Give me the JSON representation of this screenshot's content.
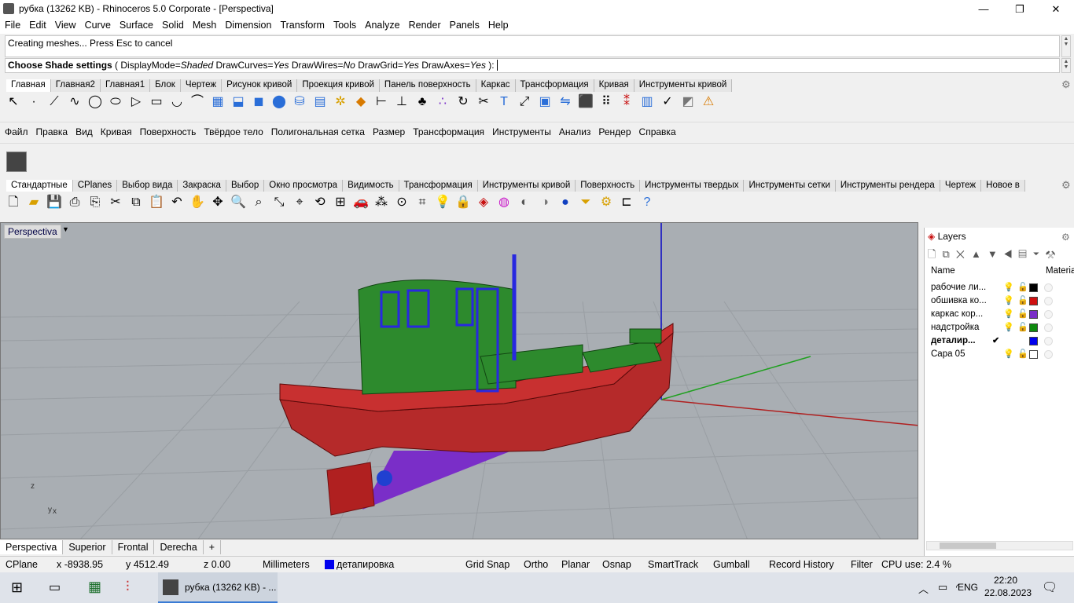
{
  "window": {
    "title": "рубка (13262 KB) - Rhinoceros  5.0 Corporate - [Perspectiva]",
    "minimize": "—",
    "restore": "❐",
    "close": "✕"
  },
  "menu": [
    "File",
    "Edit",
    "View",
    "Curve",
    "Surface",
    "Solid",
    "Mesh",
    "Dimension",
    "Transform",
    "Tools",
    "Analyze",
    "Render",
    "Panels",
    "Help"
  ],
  "command": {
    "history": "Creating meshes... Press Esc to cancel",
    "prompt_bold": "Choose Shade settings",
    "prompt_rest": " ( DisplayMode=",
    "displaymode": "Shaded",
    "drawcurves_lbl": " DrawCurves=",
    "drawcurves": "Yes",
    "drawwires_lbl": " DrawWires=",
    "drawwires": "No",
    "drawgrid_lbl": " DrawGrid=",
    "drawgrid": "Yes",
    "drawaxes_lbl": " DrawAxes=",
    "drawaxes": "Yes",
    "prompt_end": " ): "
  },
  "toolbar_tabs1": [
    "Главная",
    "Главная2",
    "Главная1",
    "Блок",
    "Чертеж",
    "Рисунок кривой",
    "Проекция кривой",
    "Панель поверхность",
    "Каркас",
    "Трансформация",
    "Кривая",
    "Инструменты кривой"
  ],
  "toolbar_text": [
    "Файл",
    "Правка",
    "Вид",
    "Кривая",
    "Поверхность",
    "Твёрдое тело",
    "Полигональная сетка",
    "Размер",
    "Трансформация",
    "Инструменты",
    "Анализ",
    "Рендер",
    "Справка"
  ],
  "toolbar_tabs2": [
    "Стандартные",
    "CPlanes",
    "Выбор вида",
    "Закраска",
    "Выбор",
    "Окно просмотра",
    "Видимость",
    "Трансформация",
    "Инструменты кривой",
    "Поверхность",
    "Инструменты твердых",
    "Инструменты сетки",
    "Инструменты рендера",
    "Чертеж",
    "Новое в"
  ],
  "viewport": {
    "label": "Perspectiva",
    "axis_z": "z",
    "axis_y": "y",
    "axis_x": "x"
  },
  "layers": {
    "title": "Layers",
    "col_name": "Name",
    "col_material": "Material",
    "rows": [
      {
        "name": "рабочие ли...",
        "color": "#000000",
        "current": false
      },
      {
        "name": "обшивка ко...",
        "color": "#d01010",
        "current": false
      },
      {
        "name": "каркас кор...",
        "color": "#7a2ec8",
        "current": false
      },
      {
        "name": "надстройка",
        "color": "#0e8a0e",
        "current": false
      },
      {
        "name": "деталир...",
        "color": "#0000ee",
        "current": true
      },
      {
        "name": "Capa 05",
        "color": "#ffffff",
        "current": false
      }
    ],
    "check": "✔"
  },
  "viewport_tabs": [
    "Perspectiva",
    "Superior",
    "Frontal",
    "Derecha"
  ],
  "add_tab": "+",
  "status": {
    "cplane": "CPlane",
    "x": "x -8938.95",
    "y": "y 4512.49",
    "z": "z 0.00",
    "units": "Millimeters",
    "layer": "детапировка",
    "toggles": [
      "Grid Snap",
      "Ortho",
      "Planar",
      "Osnap",
      "SmartTrack",
      "Gumball",
      "Record History",
      "Filter"
    ],
    "cpu": "CPU use: 2.4 %"
  },
  "taskbar": {
    "app_label": "рубка (13262 KB) - ...",
    "lang": "ENG",
    "time": "22:20",
    "date": "22.08.2023"
  }
}
